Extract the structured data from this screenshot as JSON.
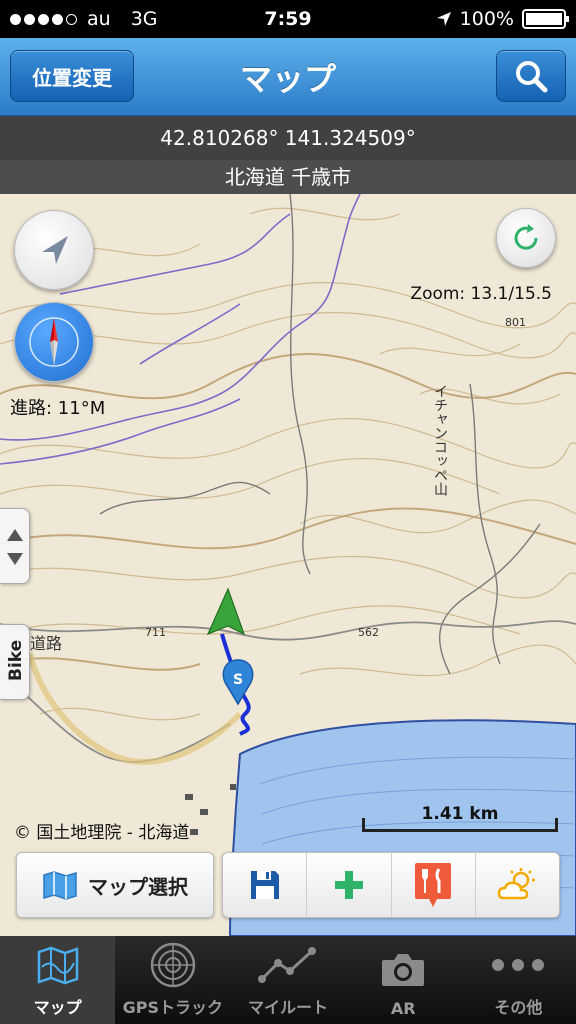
{
  "status_bar": {
    "carrier": "au",
    "network": "3G",
    "time": "7:59",
    "battery": "100%"
  },
  "nav": {
    "title": "マップ",
    "left_button": "位置変更",
    "right_icon": "search-icon"
  },
  "location": {
    "coordinates": "42.810268° 141.324509°",
    "place": "北海道 千歳市"
  },
  "map": {
    "zoom": "Zoom: 13.1/15.5",
    "heading": "進路: 11°M",
    "copyright": "© 国土地理院 - 北海道",
    "scale": "1.41 km",
    "bike_tab": "Bike",
    "labels": {
      "mountain": "イチャンコッペ山",
      "road": "道路",
      "elev1": "801",
      "elev2": "562",
      "elev3": "711"
    }
  },
  "toolbar": {
    "map_select": "マップ選択",
    "actions": [
      "save-icon",
      "add-icon",
      "restaurant-icon",
      "weather-icon"
    ]
  },
  "tabs": [
    {
      "label": "マップ",
      "icon": "map-icon",
      "active": true
    },
    {
      "label": "GPSトラック",
      "icon": "radar-icon",
      "active": false
    },
    {
      "label": "マイルート",
      "icon": "route-icon",
      "active": false
    },
    {
      "label": "AR",
      "icon": "camera-icon",
      "active": false
    },
    {
      "label": "その他",
      "icon": "more-icon",
      "active": false
    }
  ],
  "colors": {
    "nav_blue": "#2c7cc8",
    "lake": "#9fc4ee",
    "track": "#1a2fd6",
    "arrow_green": "#2c9a2c"
  }
}
